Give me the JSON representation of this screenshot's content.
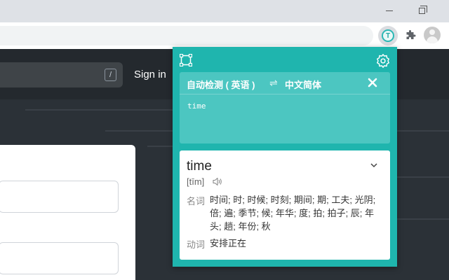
{
  "window": {
    "minimize_icon": "minimize-icon",
    "maximize_icon": "restore-icon"
  },
  "extensions": {
    "translate_icon": "translate-extension-icon",
    "translate_letter": "T",
    "puzzle_icon": "puzzle-icon",
    "avatar_icon": "profile-avatar"
  },
  "page": {
    "search_shortcut": "/",
    "signin_label": "Sign in",
    "colors": {
      "header_bg": "#24292e",
      "body_bg": "#2b3137"
    }
  },
  "translator": {
    "colors": {
      "accent": "#1fb5ae",
      "panel": "#4cc6c1"
    },
    "source_language": "自动检测 ( 英语 )",
    "swap_symbol": "⇌",
    "target_language": "中文简体",
    "input_text": "time",
    "result": {
      "word": "time",
      "phonetic": "[tīm]",
      "entries": [
        {
          "pos": "名词",
          "definition": "时间; 时; 时候; 时刻; 期间; 期; 工夫; 光阴; 倍; 遍; 季节; 候; 年华; 度; 拍; 拍子; 辰; 年头; 趟; 年份; 秋"
        },
        {
          "pos": "动词",
          "definition": "安排正在"
        }
      ]
    }
  }
}
